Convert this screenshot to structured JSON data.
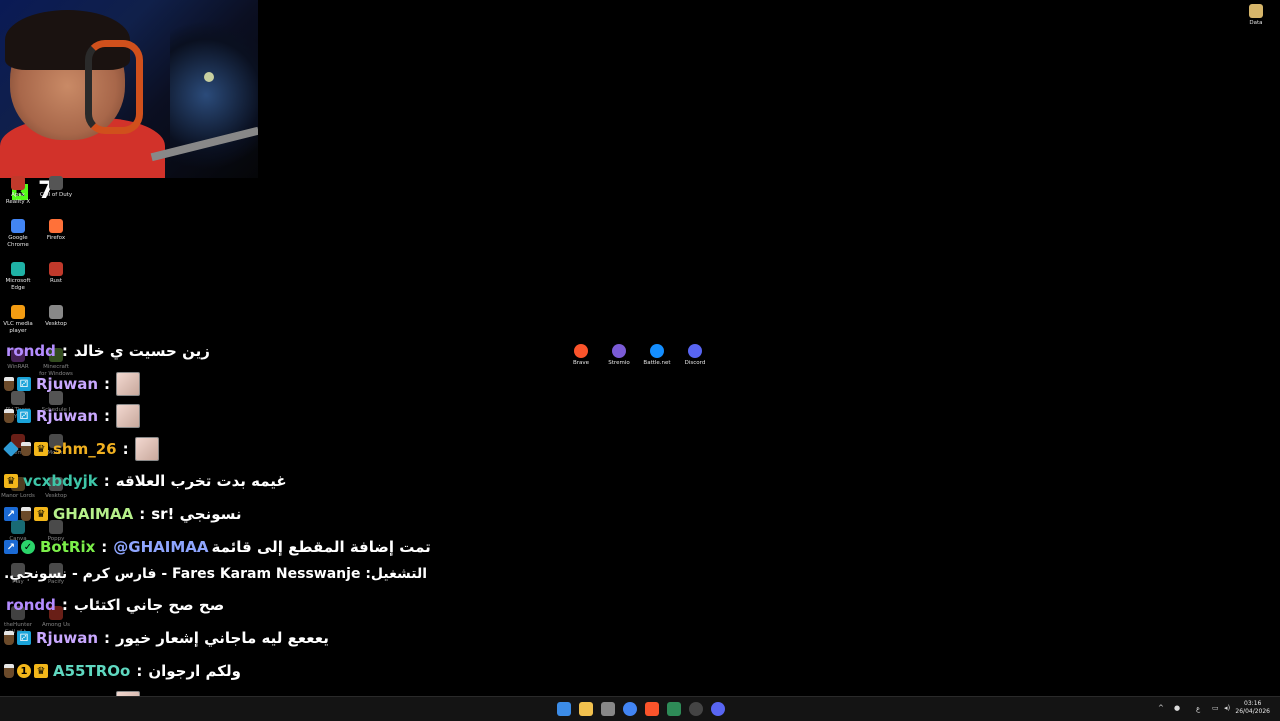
{
  "top_right_icon": {
    "label": "Data",
    "icon": "folder-icon"
  },
  "overlay_number": "7",
  "desktop_icons_left": [
    {
      "label": "Apex Reality X",
      "icon": "apex-icon",
      "color": "#c0392b"
    },
    {
      "label": "Call of Duty",
      "icon": "cod-icon",
      "color": "#555555"
    },
    {
      "label": "Google Chrome",
      "icon": "chrome-icon",
      "color": "#4285f4"
    },
    {
      "label": "Firefox",
      "icon": "firefox-icon",
      "color": "#ff7139"
    },
    {
      "label": "Microsoft Edge",
      "icon": "edge-icon",
      "color": "#1fb2a6"
    },
    {
      "label": "Rust",
      "icon": "rust-icon",
      "color": "#c0392b"
    },
    {
      "label": "VLC media player",
      "icon": "vlc-icon",
      "color": "#f39c12"
    },
    {
      "label": "Vesktop",
      "icon": "vesktop-icon",
      "color": "#888888"
    },
    {
      "label": "WinRAR",
      "icon": "winrar-icon",
      "color": "#7d3c98"
    },
    {
      "label": "Minecraft for Windows",
      "icon": "minecraft-icon",
      "color": "#5d8a3a"
    },
    {
      "label": "RV There Yet",
      "icon": "rv-icon",
      "color": "#999999"
    },
    {
      "label": "Schedule I",
      "icon": "schedule-icon",
      "color": "#999999"
    },
    {
      "label": "Demo",
      "icon": "demo-icon",
      "color": "#c0392b"
    },
    {
      "label": "Mount",
      "icon": "mount-icon",
      "color": "#888888"
    },
    {
      "label": "Manor Lords",
      "icon": "manor-icon",
      "color": "#8e6e3a"
    },
    {
      "label": "Vesktop",
      "icon": "vesktop-icon",
      "color": "#888888"
    },
    {
      "label": "Canva",
      "icon": "canva-icon",
      "color": "#2ec4d4"
    },
    {
      "label": "Poppy",
      "icon": "poppy-icon",
      "color": "#888888"
    },
    {
      "label": "Play",
      "icon": "play-icon",
      "color": "#888888"
    },
    {
      "label": "Pacify",
      "icon": "pacify-icon",
      "color": "#888888"
    },
    {
      "label": "theHunter Call of t...",
      "icon": "hunter-icon",
      "color": "#777777"
    },
    {
      "label": "Among Us",
      "icon": "among-icon",
      "color": "#c0392b"
    }
  ],
  "desktop_icons_center": [
    {
      "label": "Brave",
      "icon": "brave-icon",
      "color": "#fb542b"
    },
    {
      "label": "Stremio",
      "icon": "stremio-icon",
      "color": "#7b5bd6"
    },
    {
      "label": "Battle.net",
      "icon": "battlenet-icon",
      "color": "#148eff"
    },
    {
      "label": "Discord",
      "icon": "discord-icon",
      "color": "#5865f2"
    }
  ],
  "chat": [
    {
      "badges": [],
      "user": "rondd",
      "user_color": "#b48cff",
      "message": "زين حسيت ي خالد",
      "emote": false
    },
    {
      "badges": [
        "cup",
        "sub"
      ],
      "user": "Rjuwan",
      "user_color": "#c9a8ff",
      "message": "",
      "emote": true
    },
    {
      "badges": [
        "cup",
        "sub"
      ],
      "user": "Rjuwan",
      "user_color": "#c9a8ff",
      "message": "",
      "emote": true
    },
    {
      "badges": [
        "cube",
        "cup",
        "crown"
      ],
      "user": "shm_26",
      "user_color": "#f0b020",
      "message": "",
      "emote": true
    },
    {
      "badges": [
        "crown"
      ],
      "user": "vcxbdyjk",
      "user_color": "#3ec6a8",
      "message": "غيمه بدت تخرب العلاقه",
      "emote": false
    },
    {
      "badges": [
        "vip",
        "cup",
        "crown"
      ],
      "user": "GHAIMAA",
      "user_color": "#b6f08a",
      "message": "نسونجي !sr",
      "emote": false
    },
    {
      "badges": [
        "vip",
        "check"
      ],
      "user": "BotRix",
      "user_color": "#7cf04a",
      "message_mention": "@GHAIMAA",
      "message": "تمت إضافة المقطع إلى قائمة",
      "emote": false
    },
    {
      "continuation": "التشغيل: Fares Karam Nesswanje - فارس كرم - نسونجي."
    },
    {
      "badges": [],
      "user": "rondd",
      "user_color": "#b48cff",
      "message": "صح صح جاني اكتئاب",
      "emote": false
    },
    {
      "badges": [
        "cup",
        "sub"
      ],
      "user": "Rjuwan",
      "user_color": "#c9a8ff",
      "message": "يعععع ليه ماجاني إشعار خيور",
      "emote": false
    },
    {
      "badges": [
        "cup",
        "one",
        "crown"
      ],
      "user": "A55TROo",
      "user_color": "#5fd8c0",
      "message": "ولكم ارجوان",
      "emote": false
    },
    {
      "badges": [
        "cup",
        "sub"
      ],
      "user": "Rjuwan",
      "user_color": "#c9a8ff",
      "message": "",
      "emote": true
    }
  ],
  "taskbar": {
    "apps": [
      {
        "icon": "start-icon",
        "color": "#3c8ce7"
      },
      {
        "icon": "file-explorer-icon",
        "color": "#f2c14e"
      },
      {
        "icon": "store-icon",
        "color": "#888888"
      },
      {
        "icon": "chrome-icon",
        "color": "#4285f4"
      },
      {
        "icon": "brave-icon",
        "color": "#fb542b"
      },
      {
        "icon": "terminal-icon",
        "color": "#2e8b57"
      },
      {
        "icon": "obs-icon",
        "color": "#444444"
      },
      {
        "icon": "discord-icon",
        "color": "#5865f2"
      }
    ],
    "clock_time": "03:16",
    "clock_date": "26/04/2026",
    "lang": "ع"
  }
}
